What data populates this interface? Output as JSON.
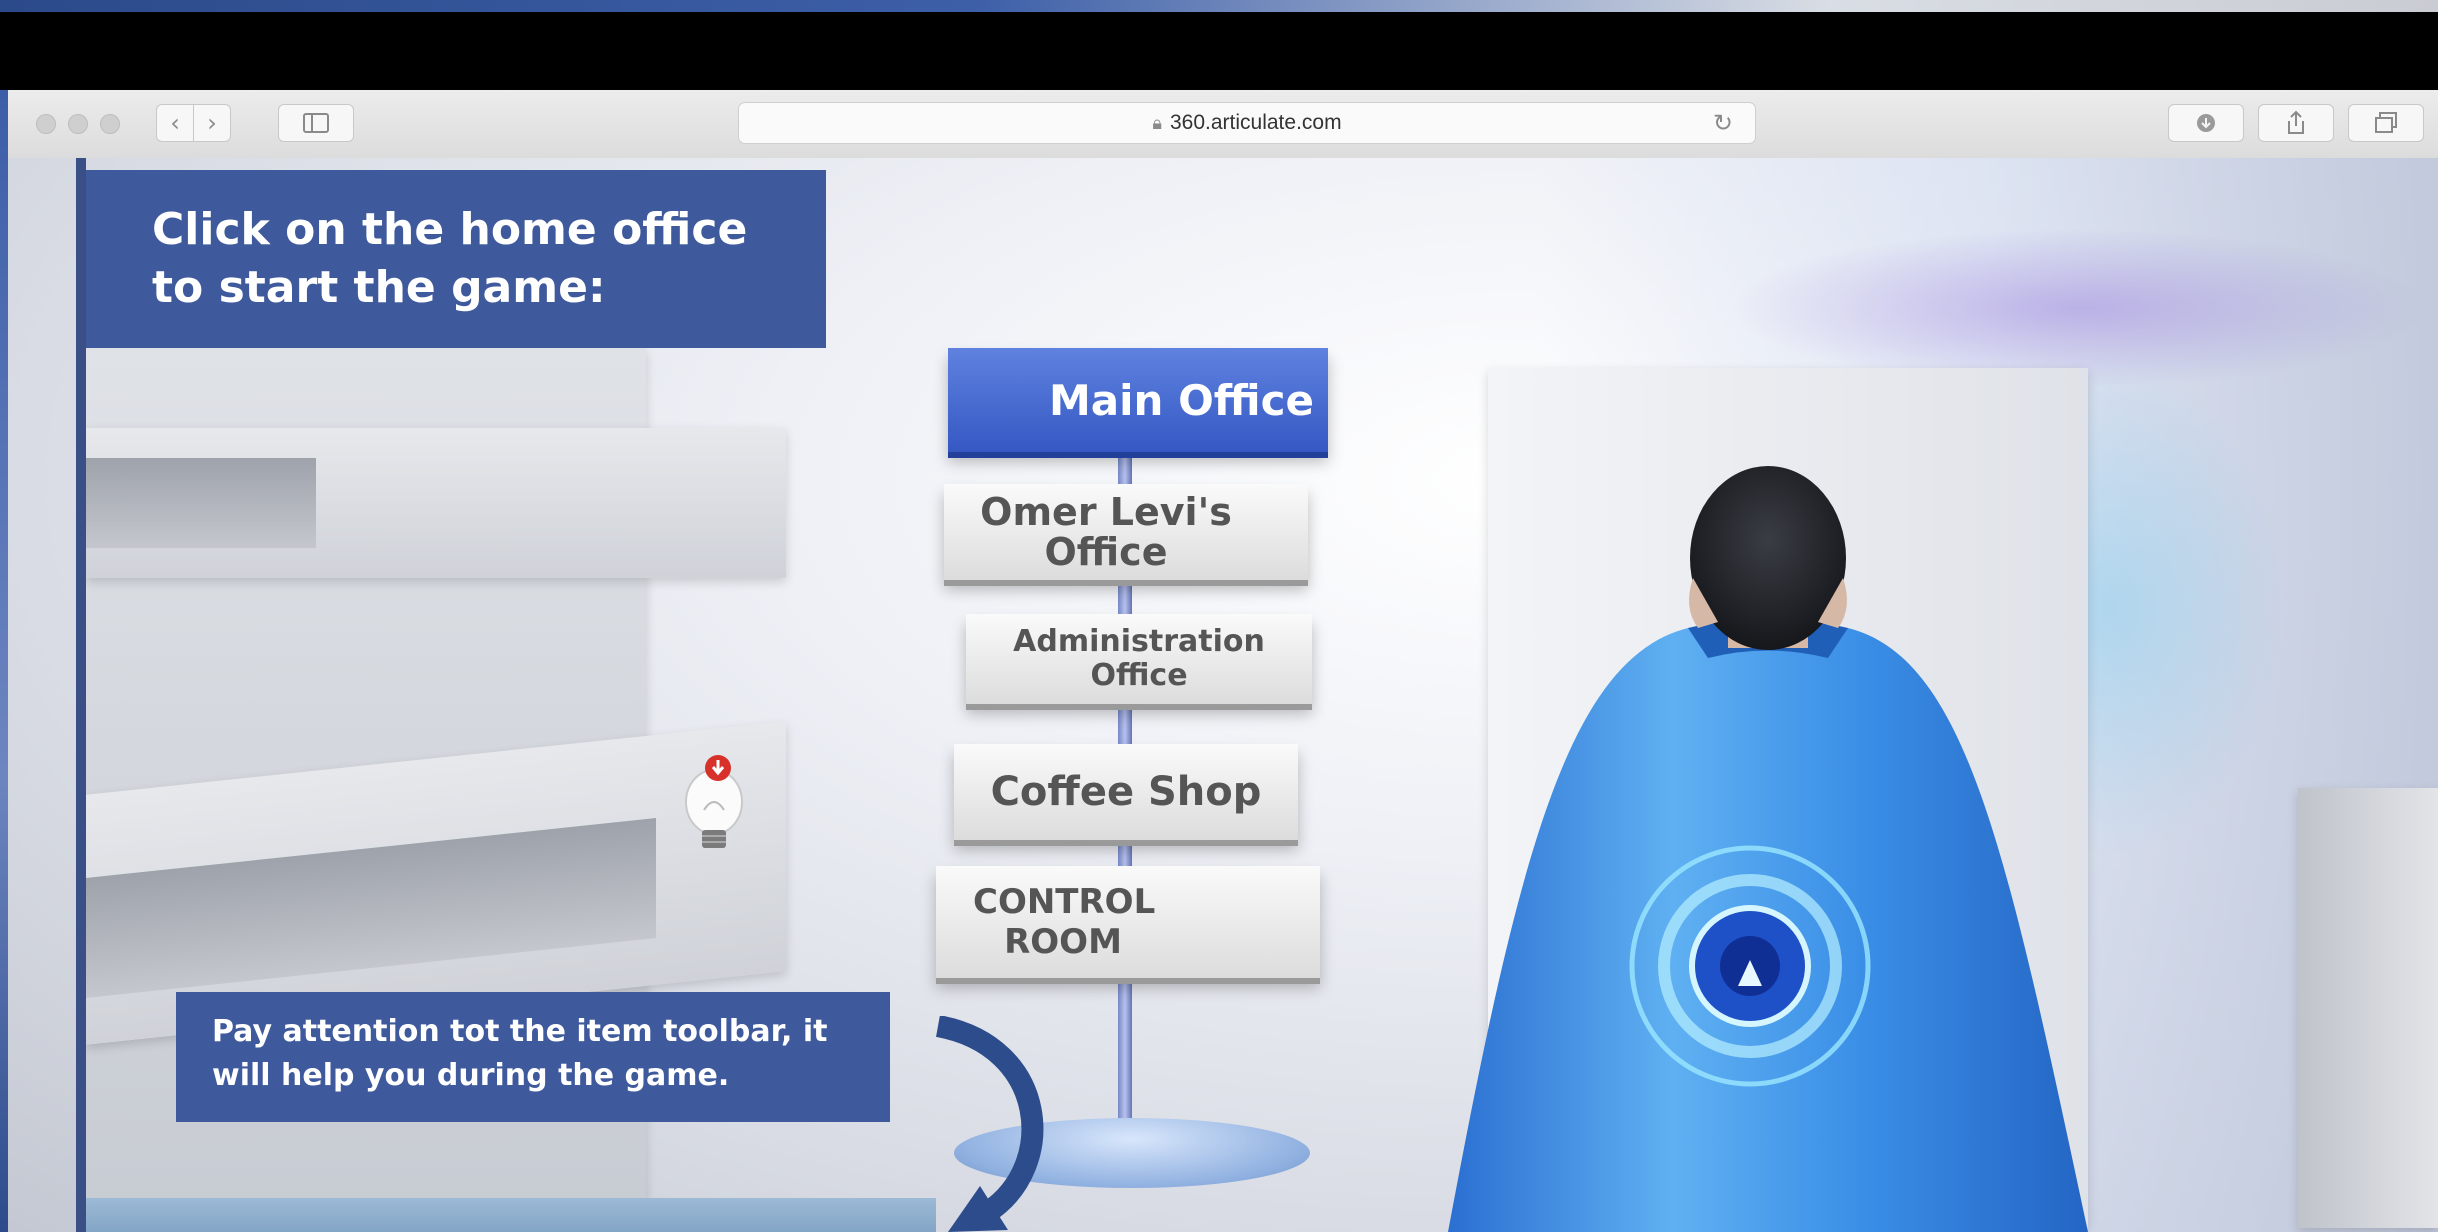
{
  "browser": {
    "url": "360.articulate.com",
    "icons": {
      "back": "chevron-left-icon",
      "forward": "chevron-right-icon",
      "sidebar": "sidebar-icon",
      "lock": "lock-icon",
      "reload": "reload-icon",
      "downloads": "download-icon",
      "share": "share-icon",
      "tabs": "tabs-icon"
    }
  },
  "game": {
    "instruction": "Click on the home office to start the game:",
    "signs": [
      {
        "label": "Main Office"
      },
      {
        "label": "Omer Levi's Office"
      },
      {
        "label": "Administration Office"
      },
      {
        "label": "Coffee Shop"
      },
      {
        "label": "CONTROL ROOM"
      }
    ],
    "tip": "Pay attention tot the item toolbar, it will help you during the game.",
    "colors": {
      "panel": "#3f5a9c",
      "sign_accent": "#3558c3",
      "hero_cape": "#3c8ee0"
    }
  }
}
